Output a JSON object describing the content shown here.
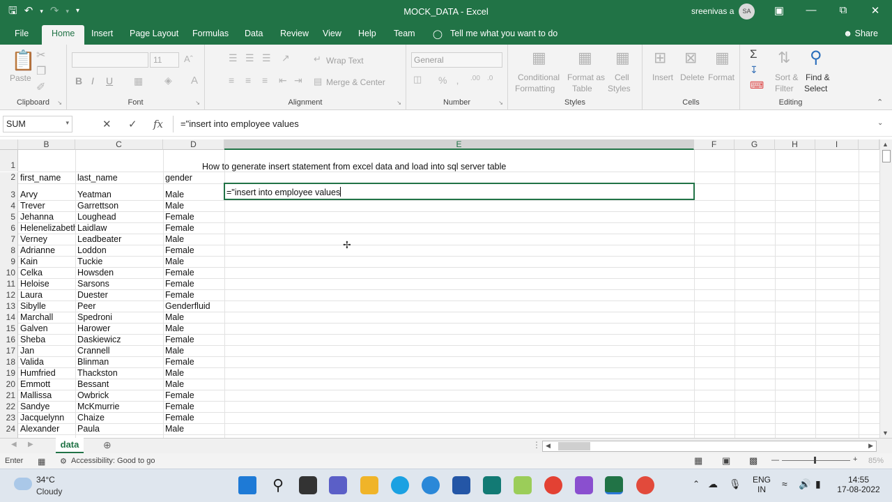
{
  "window": {
    "title": "MOCK_DATA  -  Excel",
    "user_name": "sreenivas a",
    "user_initials": "SA"
  },
  "ribbon_tabs": [
    {
      "label": "File"
    },
    {
      "label": "Home"
    },
    {
      "label": "Insert"
    },
    {
      "label": "Page Layout"
    },
    {
      "label": "Formulas"
    },
    {
      "label": "Data"
    },
    {
      "label": "Review"
    },
    {
      "label": "View"
    },
    {
      "label": "Help"
    },
    {
      "label": "Team"
    }
  ],
  "tell_me": "Tell me what you want to do",
  "share_label": "Share",
  "ribbon": {
    "clipboard": {
      "paste": "Paste",
      "label": "Clipboard"
    },
    "font": {
      "size": "11",
      "label": "Font",
      "bold": "B",
      "italic": "I",
      "underline": "U"
    },
    "alignment": {
      "wrap_text": "Wrap Text",
      "merge_center": "Merge & Center",
      "label": "Alignment"
    },
    "number": {
      "format": "General",
      "label": "Number"
    },
    "styles": {
      "conditional": "Conditional",
      "formatting": "Formatting",
      "format_as": "Format as",
      "table": "Table",
      "cell": "Cell",
      "cell_styles": "Styles",
      "label": "Styles"
    },
    "cells": {
      "insert": "Insert",
      "delete": "Delete",
      "format": "Format",
      "label": "Cells"
    },
    "editing": {
      "sort_filter_1": "Sort &",
      "sort_filter_2": "Filter",
      "find_select_1": "Find &",
      "find_select_2": "Select",
      "label": "Editing"
    }
  },
  "formula_bar": {
    "name_box": "SUM",
    "formula": "=\"insert into employee values"
  },
  "columns": [
    "B",
    "C",
    "D",
    "E",
    "F",
    "G",
    "H",
    "I"
  ],
  "sheet_title": "How to generate insert statement from excel data and load into sql server table",
  "header_row": {
    "first_name": "first_name",
    "last_name": "last_name",
    "gender": "gender"
  },
  "active_cell_text": "=\"insert into employee values",
  "rows": [
    {
      "n": "3",
      "first": "Arvy",
      "last": "Yeatman",
      "gender": "Male"
    },
    {
      "n": "4",
      "first": "Trever",
      "last": "Garrettson",
      "gender": "Male"
    },
    {
      "n": "5",
      "first": "Jehanna",
      "last": "Loughead",
      "gender": "Female"
    },
    {
      "n": "6",
      "first": "Helenelizabeth",
      "last": "Laidlaw",
      "gender": "Female"
    },
    {
      "n": "7",
      "first": "Verney",
      "last": "Leadbeater",
      "gender": "Male"
    },
    {
      "n": "8",
      "first": "Adrianne",
      "last": "Loddon",
      "gender": "Female"
    },
    {
      "n": "9",
      "first": "Kain",
      "last": "Tuckie",
      "gender": "Male"
    },
    {
      "n": "10",
      "first": "Celka",
      "last": "Howsden",
      "gender": "Female"
    },
    {
      "n": "11",
      "first": "Heloise",
      "last": "Sarsons",
      "gender": "Female"
    },
    {
      "n": "12",
      "first": "Laura",
      "last": "Duester",
      "gender": "Female"
    },
    {
      "n": "13",
      "first": "Sibylle",
      "last": "Peer",
      "gender": "Genderfluid"
    },
    {
      "n": "14",
      "first": "Marchall",
      "last": "Spedroni",
      "gender": "Male"
    },
    {
      "n": "15",
      "first": "Galven",
      "last": "Harower",
      "gender": "Male"
    },
    {
      "n": "16",
      "first": "Sheba",
      "last": "Daskiewicz",
      "gender": "Female"
    },
    {
      "n": "17",
      "first": "Jan",
      "last": "Crannell",
      "gender": "Male"
    },
    {
      "n": "18",
      "first": "Valida",
      "last": "Blinman",
      "gender": "Female"
    },
    {
      "n": "19",
      "first": "Humfried",
      "last": "Thackston",
      "gender": "Male"
    },
    {
      "n": "20",
      "first": "Emmott",
      "last": "Bessant",
      "gender": "Male"
    },
    {
      "n": "21",
      "first": "Mallissa",
      "last": "Owbrick",
      "gender": "Female"
    },
    {
      "n": "22",
      "first": "Sandye",
      "last": "McKmurrie",
      "gender": "Female"
    },
    {
      "n": "23",
      "first": "Jacquelynn",
      "last": "Chaize",
      "gender": "Female"
    },
    {
      "n": "24",
      "first": "Alexander",
      "last": "Paula",
      "gender": "Male"
    }
  ],
  "sheet_tab": "data",
  "status": {
    "mode": "Enter",
    "accessibility": "Accessibility: Good to go",
    "zoom": "85%"
  },
  "taskbar": {
    "temperature": "34°C",
    "weather": "Cloudy",
    "lang_1": "ENG",
    "lang_2": "IN",
    "time": "14:55",
    "date": "17-08-2022"
  },
  "colors": {
    "excel_green": "#217346"
  }
}
